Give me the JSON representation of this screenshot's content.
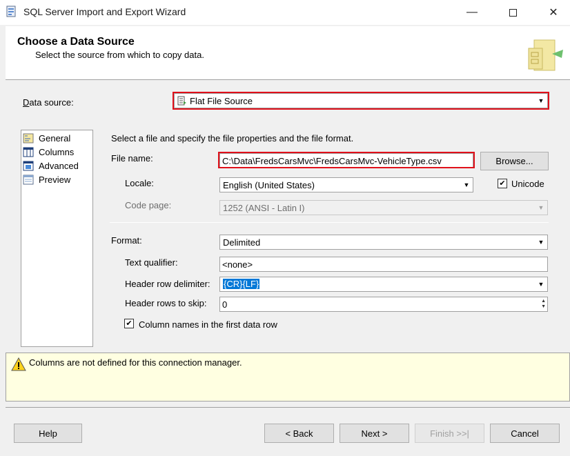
{
  "window": {
    "title": "SQL Server Import and Export Wizard"
  },
  "header": {
    "title": "Choose a Data Source",
    "subtitle": "Select the source from which to copy data."
  },
  "datasource": {
    "label": "Data source:",
    "value": "Flat File Source"
  },
  "nav": {
    "items": [
      {
        "label": "General"
      },
      {
        "label": "Columns"
      },
      {
        "label": "Advanced"
      },
      {
        "label": "Preview"
      }
    ]
  },
  "general": {
    "instruction": "Select a file and specify the file properties and the file format.",
    "file_name_label": "File name:",
    "file_name_value": "C:\\Data\\FredsCarsMvc\\FredsCarsMvc-VehicleType.csv",
    "browse_label": "Browse...",
    "locale_label": "Locale:",
    "locale_value": "English (United States)",
    "unicode_label": "Unicode",
    "codepage_label": "Code page:",
    "codepage_value": "1252  (ANSI - Latin I)",
    "format_label": "Format:",
    "format_value": "Delimited",
    "text_qualifier_label": "Text qualifier:",
    "text_qualifier_value": "<none>",
    "header_row_delim_label": "Header row delimiter:",
    "header_row_delim_value": "{CR}{LF}",
    "header_rows_skip_label": "Header rows to skip:",
    "header_rows_skip_value": "0",
    "column_names_label": "Column names in the first data row"
  },
  "message": {
    "text": "Columns are not defined for this connection manager."
  },
  "buttons": {
    "help": "Help",
    "back": "< Back",
    "next": "Next >",
    "finish": "Finish >>|",
    "cancel": "Cancel"
  },
  "colors": {
    "highlight": "#e0101a",
    "selection": "#0078d7",
    "message_bg": "#ffffe1"
  }
}
